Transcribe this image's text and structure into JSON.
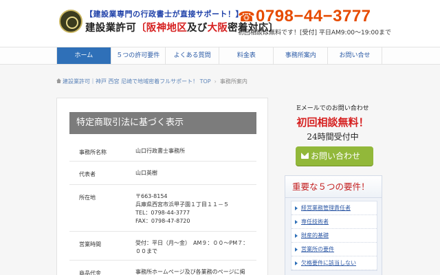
{
  "header": {
    "tagline": "【建設業専門の行政書士が直接サポート！】",
    "title_prefix": "建設業許可",
    "title_highlight_1": "〔阪神地区",
    "title_middle": "及び",
    "title_highlight_2": "大阪",
    "title_suffix": "密着対応〕",
    "tel": "0798−44−3777",
    "tel_note": "初回相談は無料です！[受付] 平日AM9:00～19:00まで"
  },
  "nav": {
    "items": [
      {
        "label": "ホーム",
        "active": true
      },
      {
        "label": "５つの許可要件",
        "active": false
      },
      {
        "label": "よくある質問",
        "active": false
      },
      {
        "label": "料金表",
        "active": false
      },
      {
        "label": "事務所案内",
        "active": false
      },
      {
        "label": "お問い合せ",
        "active": false
      }
    ]
  },
  "breadcrumb": {
    "home_link": "建設業許可｜神戸 西宮 尼崎で地域密着フルサポート！ TOP",
    "current": "事務所案内"
  },
  "main": {
    "section_title": "特定商取引法に基づく表示",
    "rows": [
      {
        "label": "事務所名称",
        "lines": [
          "山口行政書士事務所"
        ]
      },
      {
        "label": "代表者",
        "lines": [
          "山口英樹"
        ]
      },
      {
        "label": "所在地",
        "lines": [
          "〒663-8154",
          "兵庫県西宮市浜甲子園１丁目１１－５",
          "TEL：0798-44-3777",
          "FAX：0798-47-8720"
        ]
      },
      {
        "label": "営業時間",
        "lines": [
          "受付：平日（月～金）　AM９：００～PM７：",
          "００まで"
        ]
      },
      {
        "label": "商品代金",
        "lines": [
          "事務所ホームページ及び各業務のページに掲"
        ]
      }
    ]
  },
  "sidebar": {
    "mail_label": "Eメールでのお問い合わせ",
    "free_label": "初回相談無料！",
    "hours_label": "24時間受付中",
    "contact_button": "お問い合わせ",
    "requirements_title": "重要な５つの要件！",
    "requirements": [
      "経営業務管理責任者",
      "専任技術者",
      "財産的基礎",
      "営業所の要件",
      "欠格要件に該当しない"
    ]
  },
  "colors": {
    "accent": "#2f70b8",
    "tel": "#e64b00",
    "highlight_red": "#d62020",
    "button_green": "#92b83a"
  }
}
